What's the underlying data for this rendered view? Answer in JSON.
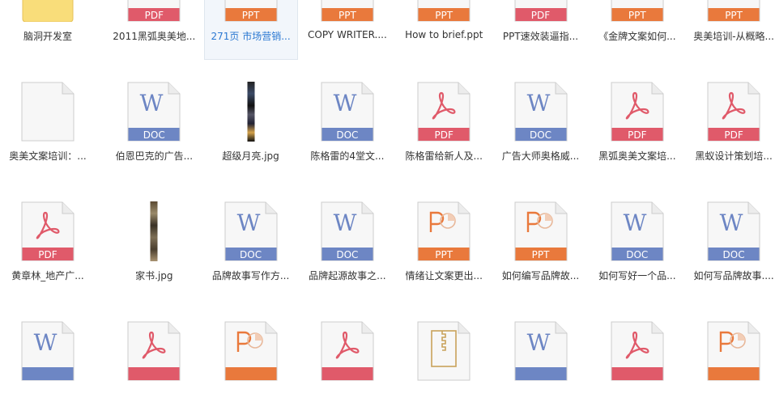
{
  "colors": {
    "pdf": "#e05a6a",
    "ppt": "#e9793c",
    "doc": "#6d86c4",
    "paper_border": "#cccccc",
    "selected_bg": "#f2f6fb"
  },
  "files": [
    {
      "name": "脑洞开发室",
      "type": "folder",
      "icon": "folder-icon"
    },
    {
      "name": "2011黑弧奥美地...",
      "type": "pdf",
      "badge": "PDF",
      "icon": "pdf-file-icon"
    },
    {
      "name": "271页 市场营销...",
      "type": "ppt",
      "badge": "PPT",
      "icon": "ppt-file-icon",
      "selected": true
    },
    {
      "name": "COPY WRITER....",
      "type": "ppt",
      "badge": "PPT",
      "icon": "ppt-file-icon"
    },
    {
      "name": "How to brief.ppt",
      "type": "ppt",
      "badge": "PPT",
      "icon": "ppt-file-icon"
    },
    {
      "name": "PPT速效装逼指...",
      "type": "pdf",
      "badge": "PDF",
      "icon": "pdf-file-icon"
    },
    {
      "name": "《金牌文案如何...",
      "type": "ppt",
      "badge": "PPT",
      "icon": "ppt-file-icon"
    },
    {
      "name": "奥美培训-从概略...",
      "type": "ppt",
      "badge": "PPT",
      "icon": "ppt-file-icon"
    },
    {
      "name": "奥美文案培训：...",
      "type": "blank",
      "icon": "blank-file-icon"
    },
    {
      "name": "伯恩巴克的广告...",
      "type": "doc",
      "badge": "DOC",
      "icon": "word-file-icon"
    },
    {
      "name": "超级月亮.jpg",
      "type": "jpg",
      "icon": "image-thumbnail-icon"
    },
    {
      "name": "陈格雷的4堂文...",
      "type": "doc",
      "badge": "DOC",
      "icon": "word-file-icon"
    },
    {
      "name": "陈格雷给新人及...",
      "type": "pdf",
      "badge": "PDF",
      "icon": "pdf-file-icon"
    },
    {
      "name": "广告大师奥格威...",
      "type": "doc",
      "badge": "DOC",
      "icon": "word-file-icon"
    },
    {
      "name": "黑弧奥美文案培...",
      "type": "pdf",
      "badge": "PDF",
      "icon": "pdf-file-icon"
    },
    {
      "name": "黑蚁设计策划培...",
      "type": "pdf",
      "badge": "PDF",
      "icon": "pdf-file-icon"
    },
    {
      "name": "黄章林_地产广...",
      "type": "pdf",
      "badge": "PDF",
      "icon": "pdf-file-icon"
    },
    {
      "name": "家书.jpg",
      "type": "jpg",
      "icon": "image-thumbnail-icon"
    },
    {
      "name": "品牌故事写作方...",
      "type": "doc",
      "badge": "DOC",
      "icon": "word-file-icon"
    },
    {
      "name": "品牌起源故事之...",
      "type": "doc",
      "badge": "DOC",
      "icon": "word-file-icon"
    },
    {
      "name": "情绪让文案更出...",
      "type": "pptp",
      "badge": "PPT",
      "icon": "powerpoint-file-icon"
    },
    {
      "name": "如何编写品牌故...",
      "type": "pptp",
      "badge": "PPT",
      "icon": "powerpoint-file-icon"
    },
    {
      "name": "如何写好一个品...",
      "type": "doc",
      "badge": "DOC",
      "icon": "word-file-icon"
    },
    {
      "name": "如何写品牌故事....",
      "type": "doc",
      "badge": "DOC",
      "icon": "word-file-icon"
    },
    {
      "name": "",
      "type": "doc",
      "badge": "",
      "icon": "word-file-icon"
    },
    {
      "name": "",
      "type": "pdf",
      "badge": "",
      "icon": "pdf-file-icon"
    },
    {
      "name": "",
      "type": "pptp",
      "badge": "",
      "icon": "powerpoint-file-icon"
    },
    {
      "name": "",
      "type": "pdf",
      "badge": "",
      "icon": "pdf-file-icon"
    },
    {
      "name": "",
      "type": "zip",
      "badge": "",
      "icon": "zip-file-icon"
    },
    {
      "name": "",
      "type": "doc",
      "badge": "",
      "icon": "word-file-icon"
    },
    {
      "name": "",
      "type": "pdf",
      "badge": "",
      "icon": "pdf-file-icon"
    },
    {
      "name": "",
      "type": "pptp",
      "badge": "",
      "icon": "powerpoint-file-icon"
    }
  ]
}
